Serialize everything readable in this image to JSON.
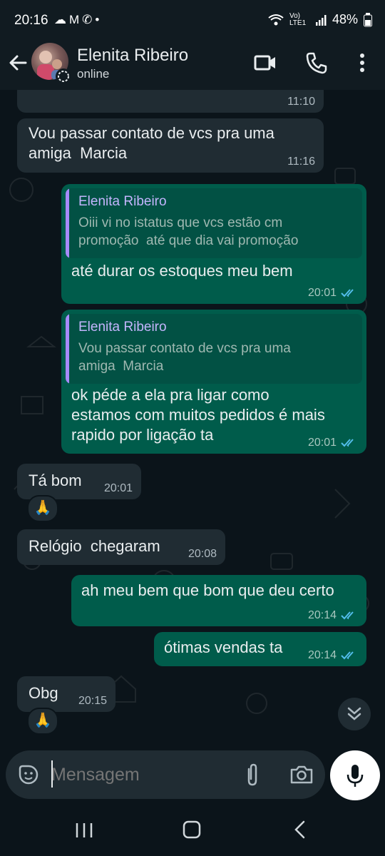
{
  "status_bar": {
    "time": "20:16",
    "notif_icons": [
      "cloud-icon",
      "gmail-icon",
      "missed-call-icon",
      "dot-icon"
    ],
    "network": "Vo) LTE1",
    "battery": "48%"
  },
  "header": {
    "contact_name": "Elenita Ribeiro",
    "contact_status": "online"
  },
  "messages": [
    {
      "dir": "in",
      "text": "",
      "time": "11:10"
    },
    {
      "dir": "in",
      "text": "Vou passar contato de vcs pra uma\namiga  Marcia",
      "time": "11:16"
    },
    {
      "dir": "out",
      "quote_name": "Elenita Ribeiro",
      "quote_text": "Oiii vi no istatus que vcs estão cm\npromoção  até que dia vai promoção",
      "text": "até durar os estoques meu bem",
      "time": "20:01"
    },
    {
      "dir": "out",
      "quote_name": "Elenita Ribeiro",
      "quote_text": "Vou passar contato de vcs pra uma\namiga  Marcia",
      "text": "ok péde a ela pra ligar como\nestamos com muitos pedidos é mais\nrapido por ligação ta",
      "time": "20:01"
    },
    {
      "dir": "in",
      "text": "Tá bom",
      "time": "20:01",
      "reaction": "🙏"
    },
    {
      "dir": "in",
      "text": "Relógio  chegaram",
      "time": "20:08"
    },
    {
      "dir": "out",
      "text": "ah meu bem que bom que deu certo",
      "time": "20:14"
    },
    {
      "dir": "out",
      "text": "ótimas vendas ta",
      "time": "20:14"
    },
    {
      "dir": "in",
      "text": "Obg",
      "time": "20:15",
      "reaction": "🙏"
    }
  ],
  "composer": {
    "placeholder": "Mensagem"
  },
  "colors": {
    "background": "#0b141a",
    "incoming_bubble": "#202c33",
    "outgoing_bubble": "#005c4b",
    "read_ticks": "#53bdeb",
    "quote_accent": "#a78bfa"
  }
}
